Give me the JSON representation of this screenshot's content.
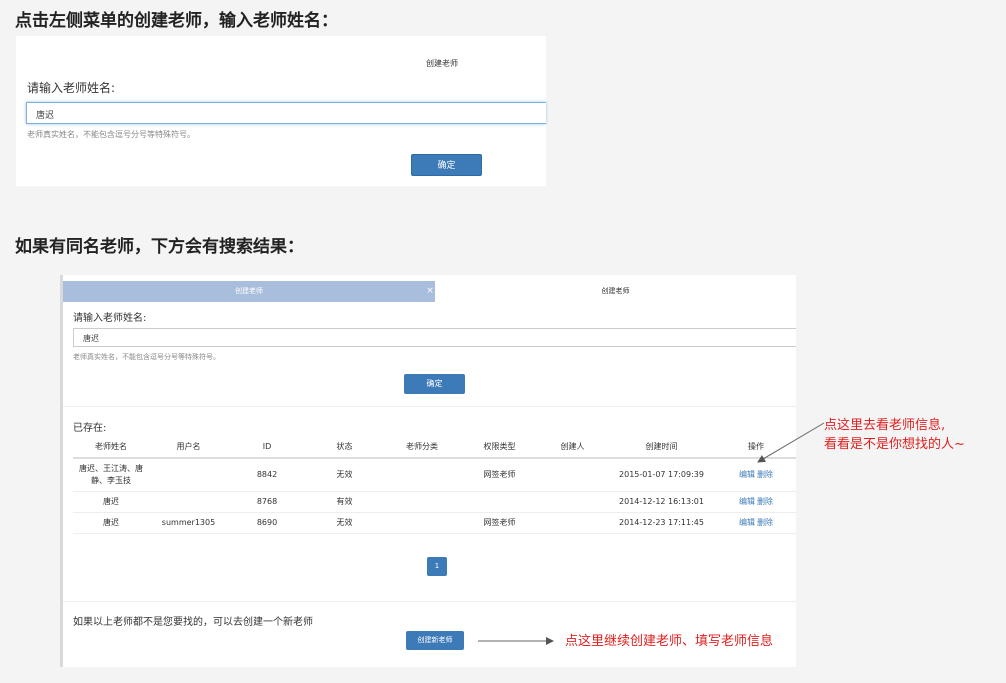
{
  "headings": {
    "step1": "点击左侧菜单的创建老师，输入老师姓名：",
    "step2": "如果有同名老师，下方会有搜索结果："
  },
  "panel1": {
    "title": "创建老师",
    "label": "请输入老师姓名:",
    "input_value": "唐迟",
    "help": "老师真实姓名，不能包含逗号分号等特殊符号。",
    "confirm": "确定"
  },
  "panel2": {
    "tab_active": "创建老师",
    "tab_close": "×",
    "tab_inactive": "创建老师",
    "label": "请输入老师姓名:",
    "input_value": "唐迟",
    "help": "老师真实姓名，不能包含逗号分号等特殊符号。",
    "confirm": "确定",
    "exists_label": "已存在:",
    "columns": [
      "老师姓名",
      "用户名",
      "ID",
      "状态",
      "老师分类",
      "权限类型",
      "创建人",
      "创建时间",
      "操作"
    ],
    "rows": [
      {
        "name": "唐迟、王江涛、唐静、李玉技",
        "username": "",
        "id": "8842",
        "status": "无效",
        "category": "",
        "perm": "网签老师",
        "creator": "",
        "created": "2015-01-07 17:09:39",
        "edit": "编辑",
        "del": "删除"
      },
      {
        "name": "唐迟",
        "username": "",
        "id": "8768",
        "status": "有效",
        "category": "",
        "perm": "",
        "creator": "",
        "created": "2014-12-12 16:13:01",
        "edit": "编辑",
        "del": "删除"
      },
      {
        "name": "唐迟",
        "username": "summer1305",
        "id": "8690",
        "status": "无效",
        "category": "",
        "perm": "网签老师",
        "creator": "",
        "created": "2014-12-23 17:11:45",
        "edit": "编辑",
        "del": "删除"
      }
    ],
    "page": "1",
    "note": "如果以上老师都不是您要找的，可以去创建一个新老师",
    "create_new": "创建新老师"
  },
  "annotations": {
    "a1_line1": "点这里去看老师信息,",
    "a1_line2": "看看是不是你想找的人~",
    "a2": "点这里继续创建老师、填写老师信息"
  },
  "colors": {
    "primary": "#3c7ab8",
    "annotation": "#e02020",
    "tab_active": "#a9bedc"
  }
}
